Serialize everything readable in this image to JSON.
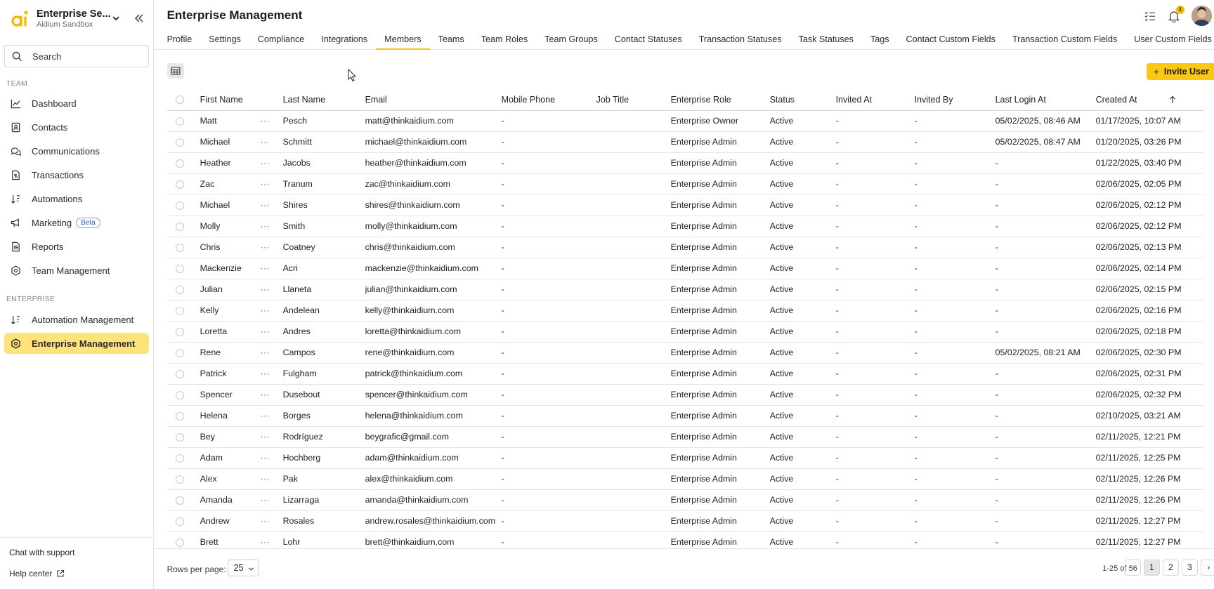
{
  "workspace": {
    "name": "Enterprise Se...",
    "sub": "Aidium Sandbox"
  },
  "search": {
    "placeholder": "Search"
  },
  "sidebar": {
    "team_label": "TEAM",
    "team_items": [
      {
        "label": "Dashboard",
        "icon": "chart-line-icon"
      },
      {
        "label": "Contacts",
        "icon": "contact-card-icon"
      },
      {
        "label": "Communications",
        "icon": "chat-bubbles-icon"
      },
      {
        "label": "Transactions",
        "icon": "document-dollar-icon"
      },
      {
        "label": "Automations",
        "icon": "sort-arrows-icon"
      },
      {
        "label": "Marketing",
        "icon": "megaphone-icon",
        "badge": "Beta"
      },
      {
        "label": "Reports",
        "icon": "report-icon"
      },
      {
        "label": "Team Management",
        "icon": "gear-icon"
      }
    ],
    "enterprise_label": "ENTERPRISE",
    "enterprise_items": [
      {
        "label": "Automation Management",
        "icon": "sort-arrows-icon"
      },
      {
        "label": "Enterprise Management",
        "icon": "gear-icon",
        "active": true
      }
    ],
    "bottom": {
      "chat": "Chat with support",
      "help": "Help center"
    }
  },
  "header": {
    "title": "Enterprise Management",
    "notifications": "4"
  },
  "tabs": [
    "Profile",
    "Settings",
    "Compliance",
    "Integrations",
    "Members",
    "Teams",
    "Team Roles",
    "Team Groups",
    "Contact Statuses",
    "Transaction Statuses",
    "Task Statuses",
    "Tags",
    "Contact Custom Fields",
    "Transaction Custom Fields",
    "User Custom Fields"
  ],
  "active_tab": "Members",
  "toolbar": {
    "invite_label": "Invite User"
  },
  "table": {
    "columns": [
      "First Name",
      "Last Name",
      "Email",
      "Mobile Phone",
      "Job Title",
      "Enterprise Role",
      "Status",
      "Invited At",
      "Invited By",
      "Last Login At",
      "Created At"
    ],
    "row_menu": "···",
    "rows": [
      [
        "Matt",
        "Pesch",
        "matt@thinkaidium.com",
        "-",
        "",
        "Enterprise Owner",
        "Active",
        "-",
        "-",
        "05/02/2025, 08:46 AM",
        "01/17/2025, 10:07 AM"
      ],
      [
        "Michael",
        "Schmitt",
        "michael@thinkaidium.com",
        "-",
        "",
        "Enterprise Admin",
        "Active",
        "-",
        "-",
        "05/02/2025, 08:47 AM",
        "01/20/2025, 03:26 PM"
      ],
      [
        "Heather",
        "Jacobs",
        "heather@thinkaidium.com",
        "-",
        "",
        "Enterprise Admin",
        "Active",
        "-",
        "-",
        "-",
        "01/22/2025, 03:40 PM"
      ],
      [
        "Zac",
        "Tranum",
        "zac@thinkaidium.com",
        "-",
        "",
        "Enterprise Admin",
        "Active",
        "-",
        "-",
        "-",
        "02/06/2025, 02:05 PM"
      ],
      [
        "Michael",
        "Shires",
        "shires@thinkaidium.com",
        "-",
        "",
        "Enterprise Admin",
        "Active",
        "-",
        "-",
        "-",
        "02/06/2025, 02:12 PM"
      ],
      [
        "Molly",
        "Smith",
        "molly@thinkaidium.com",
        "-",
        "",
        "Enterprise Admin",
        "Active",
        "-",
        "-",
        "-",
        "02/06/2025, 02:12 PM"
      ],
      [
        "Chris",
        "Coatney",
        "chris@thinkaidium.com",
        "-",
        "",
        "Enterprise Admin",
        "Active",
        "-",
        "-",
        "-",
        "02/06/2025, 02:13 PM"
      ],
      [
        "Mackenzie",
        "Acri",
        "mackenzie@thinkaidium.com",
        "-",
        "",
        "Enterprise Admin",
        "Active",
        "-",
        "-",
        "-",
        "02/06/2025, 02:14 PM"
      ],
      [
        "Julian",
        "Llaneta",
        "julian@thinkaidium.com",
        "-",
        "",
        "Enterprise Admin",
        "Active",
        "-",
        "-",
        "-",
        "02/06/2025, 02:15 PM"
      ],
      [
        "Kelly",
        "Andelean",
        "kelly@thinkaidium.com",
        "-",
        "",
        "Enterprise Admin",
        "Active",
        "-",
        "-",
        "-",
        "02/06/2025, 02:16 PM"
      ],
      [
        "Loretta",
        "Andres",
        "loretta@thinkaidium.com",
        "-",
        "",
        "Enterprise Admin",
        "Active",
        "-",
        "-",
        "-",
        "02/06/2025, 02:18 PM"
      ],
      [
        "Rene",
        "Campos",
        "rene@thinkaidium.com",
        "-",
        "",
        "Enterprise Admin",
        "Active",
        "-",
        "-",
        "05/02/2025, 08:21 AM",
        "02/06/2025, 02:30 PM"
      ],
      [
        "Patrick",
        "Fulgham",
        "patrick@thinkaidium.com",
        "-",
        "",
        "Enterprise Admin",
        "Active",
        "-",
        "-",
        "-",
        "02/06/2025, 02:31 PM"
      ],
      [
        "Spencer",
        "Dusebout",
        "spencer@thinkaidium.com",
        "-",
        "",
        "Enterprise Admin",
        "Active",
        "-",
        "-",
        "-",
        "02/06/2025, 02:32 PM"
      ],
      [
        "Helena",
        "Borges",
        "helena@thinkaidium.com",
        "-",
        "",
        "Enterprise Admin",
        "Active",
        "-",
        "-",
        "-",
        "02/10/2025, 03:21 AM"
      ],
      [
        "Bey",
        "Rodríguez",
        "beygrafic@gmail.com",
        "-",
        "",
        "Enterprise Admin",
        "Active",
        "-",
        "-",
        "-",
        "02/11/2025, 12:21 PM"
      ],
      [
        "Adam",
        "Hochberg",
        "adam@thinkaidium.com",
        "-",
        "",
        "Enterprise Admin",
        "Active",
        "-",
        "-",
        "-",
        "02/11/2025, 12:25 PM"
      ],
      [
        "Alex",
        "Pak",
        "alex@thinkaidium.com",
        "-",
        "",
        "Enterprise Admin",
        "Active",
        "-",
        "-",
        "-",
        "02/11/2025, 12:26 PM"
      ],
      [
        "Amanda",
        "Lizarraga",
        "amanda@thinkaidium.com",
        "-",
        "",
        "Enterprise Admin",
        "Active",
        "-",
        "-",
        "-",
        "02/11/2025, 12:26 PM"
      ],
      [
        "Andrew",
        "Rosales",
        "andrew.rosales@thinkaidium.com",
        "-",
        "",
        "Enterprise Admin",
        "Active",
        "-",
        "-",
        "-",
        "02/11/2025, 12:27 PM"
      ],
      [
        "Brett",
        "Lohr",
        "brett@thinkaidium.com",
        "-",
        "",
        "Enterprise Admin",
        "Active",
        "-",
        "-",
        "-",
        "02/11/2025, 12:27 PM"
      ]
    ]
  },
  "pagination": {
    "rows_per_page_label": "Rows per page:",
    "rows_per_page": "25",
    "range": "1-25 of 56",
    "prev": "‹",
    "next": "›",
    "pages": [
      "1",
      "2",
      "3"
    ],
    "current_page": "1"
  },
  "colors": {
    "accent": "#fac712",
    "active_nav": "#fde37a"
  }
}
